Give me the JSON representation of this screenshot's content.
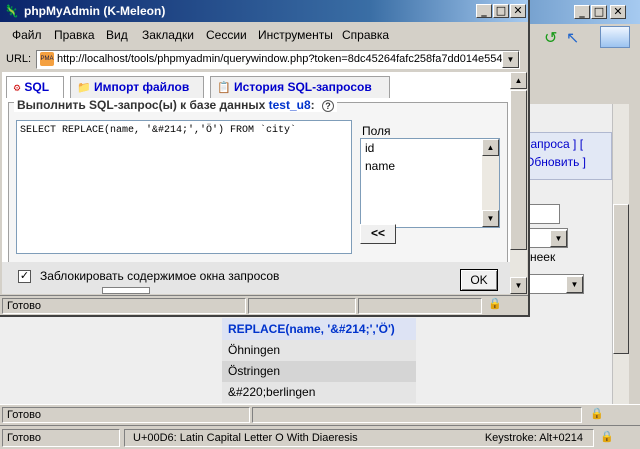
{
  "popup": {
    "title": "phpMyAdmin (K-Meleon)",
    "menu": [
      "Файл",
      "Правка",
      "Вид",
      "Закладки",
      "Сессии",
      "Инструменты",
      "Справка"
    ],
    "url_label": "URL:",
    "url": "http://localhost/tools/phpmyadmin/querywindow.php?token=8dc45264fafc258fa7dd014e554",
    "tabs": [
      "SQL",
      "Импорт файлов",
      "История SQL-запросов"
    ],
    "legend_prefix": "Выполнить SQL-запрос(ы) к базе данных",
    "db_name": "test_u8",
    "legend_suffix": ":",
    "sql_query": "SELECT REPLACE(name, '&#214;','Ö') FROM `city`",
    "fields_label": "Поля",
    "fields": [
      "id",
      "name"
    ],
    "insert_button": "<<",
    "lock_label": "Заблокировать содержимое окна запросов",
    "lock_checked": true,
    "ok_button": "OK",
    "status": "Готово"
  },
  "background": {
    "links_line1": "запроса ] [",
    "links_line2": "Обновить ]",
    "side_text": "неек",
    "result_header": "REPLACE(name, '&#214;','Ö')",
    "result_rows": [
      "Öhningen",
      "Östringen",
      "&#220;berlingen"
    ],
    "status1": "Готово",
    "status2": "Готово",
    "char_info": "U+00D6: Latin Capital Letter O With Diaeresis",
    "keystroke": "Keystroke: Alt+0214"
  },
  "colors": {
    "title_blue": "#0a246a",
    "link_blue": "#0000cc",
    "result_header_bg": "#dde3f4"
  }
}
